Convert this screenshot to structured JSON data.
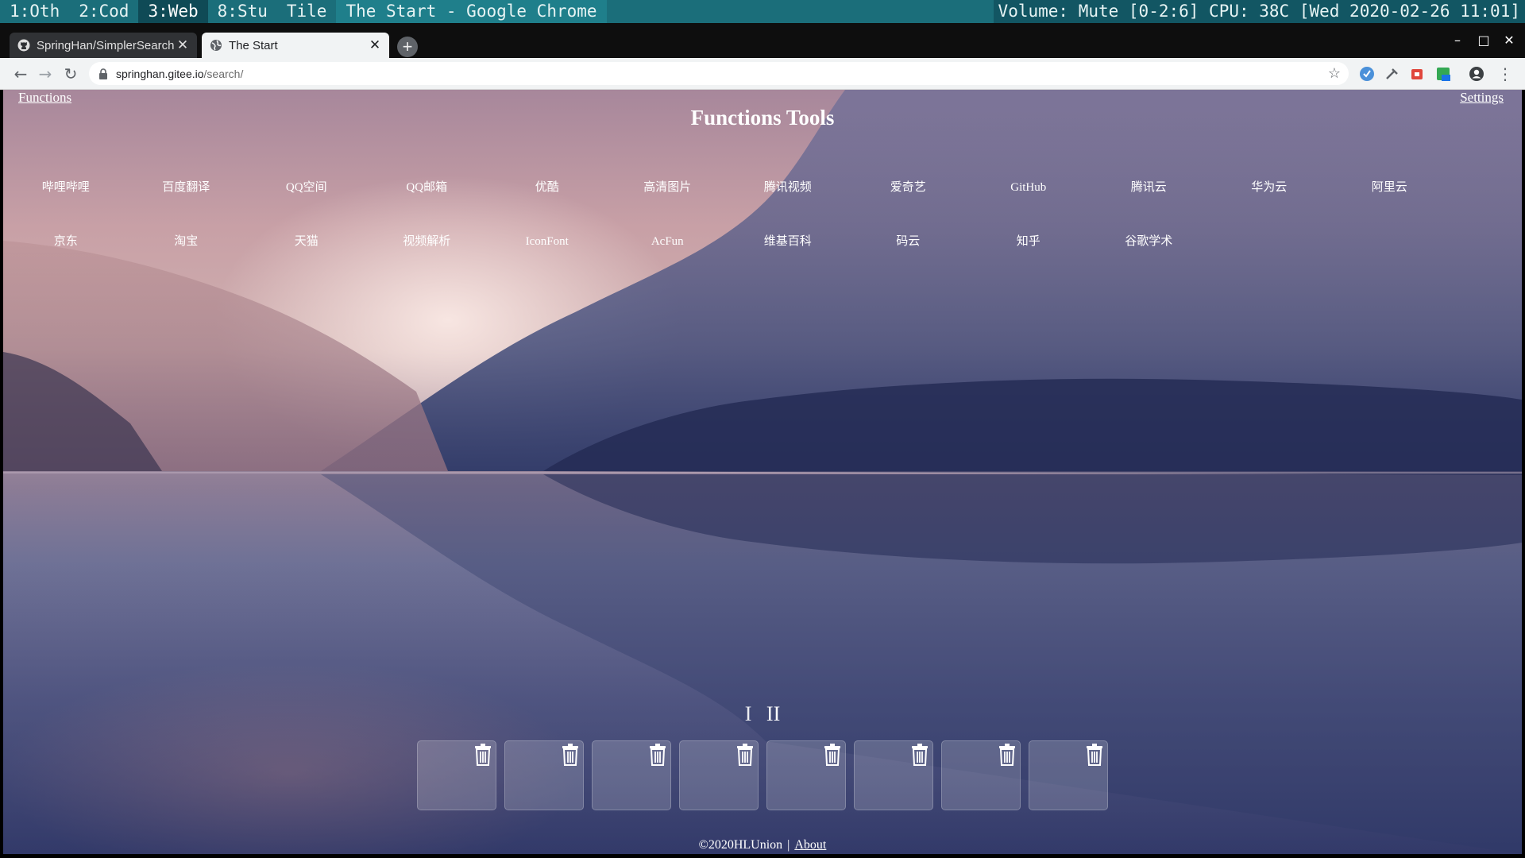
{
  "wm": {
    "workspaces": [
      "1:Oth",
      "2:Cod",
      "3:Web",
      "8:Stu",
      "Tile"
    ],
    "active_workspace": "3:Web",
    "window_title": "The Start - Google Chrome",
    "status": "Volume: Mute [0-2:6] CPU: 38C [Wed 2020-02-26 11:01]"
  },
  "browser": {
    "tabs": [
      {
        "label": "SpringHan/SimplerSearch",
        "icon": "github-icon"
      },
      {
        "label": "The Start",
        "icon": "globe-icon"
      }
    ],
    "address": {
      "host": "springhan.gitee.io",
      "path": "/search/"
    }
  },
  "page": {
    "functions_link": "Functions",
    "settings_link": "Settings",
    "title": "Functions Tools",
    "functions": [
      "哔哩哔哩",
      "百度翻译",
      "QQ空间",
      "QQ邮箱",
      "优酷",
      "高清图片",
      "腾讯视频",
      "爱奇艺",
      "GitHub",
      "腾讯云",
      "华为云",
      "阿里云",
      "京东",
      "淘宝",
      "天猫",
      "视频解析",
      "IconFont",
      "AcFun",
      "维基百科",
      "码云",
      "知乎",
      "谷歌学术"
    ],
    "pager": [
      "I",
      "II"
    ],
    "slot_count": 8,
    "footer_copyright": "©2020HLUnion",
    "footer_sep": "|",
    "footer_about": "About"
  }
}
